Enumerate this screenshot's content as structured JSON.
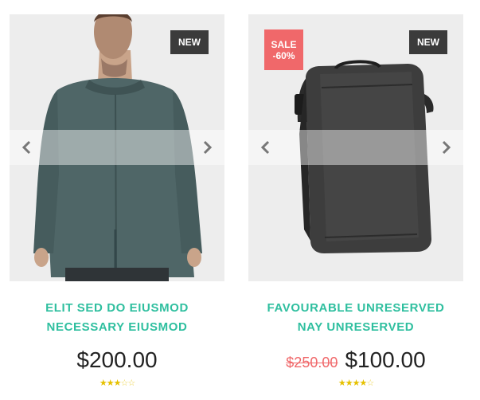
{
  "products": [
    {
      "badges": {
        "new": "NEW"
      },
      "title_line1": "ELIT SED DO EIUSMOD",
      "title_line2": "NECESSARY EIUSMOD",
      "price": "$200.00",
      "rating": 3,
      "rating_max": 5,
      "image": "jacket-back-photo"
    },
    {
      "badges": {
        "sale": "SALE",
        "discount": "-60%",
        "new": "NEW"
      },
      "title_line1": "FAVOURABLE UNRESERVED",
      "title_line2": "NAY UNRESERVED",
      "old_price": "$250.00",
      "price": "$100.00",
      "rating": 4,
      "rating_max": 5,
      "image": "crossbody-bag-photo"
    }
  ],
  "icons": {
    "prev": "chevron-left-icon",
    "next": "chevron-right-icon",
    "star": "star-icon"
  },
  "colors": {
    "title": "#2fbf9f",
    "sale_badge": "#f0686a",
    "new_badge": "#3b3b3b",
    "old_price": "#f0686a",
    "star": "#e6c100"
  }
}
